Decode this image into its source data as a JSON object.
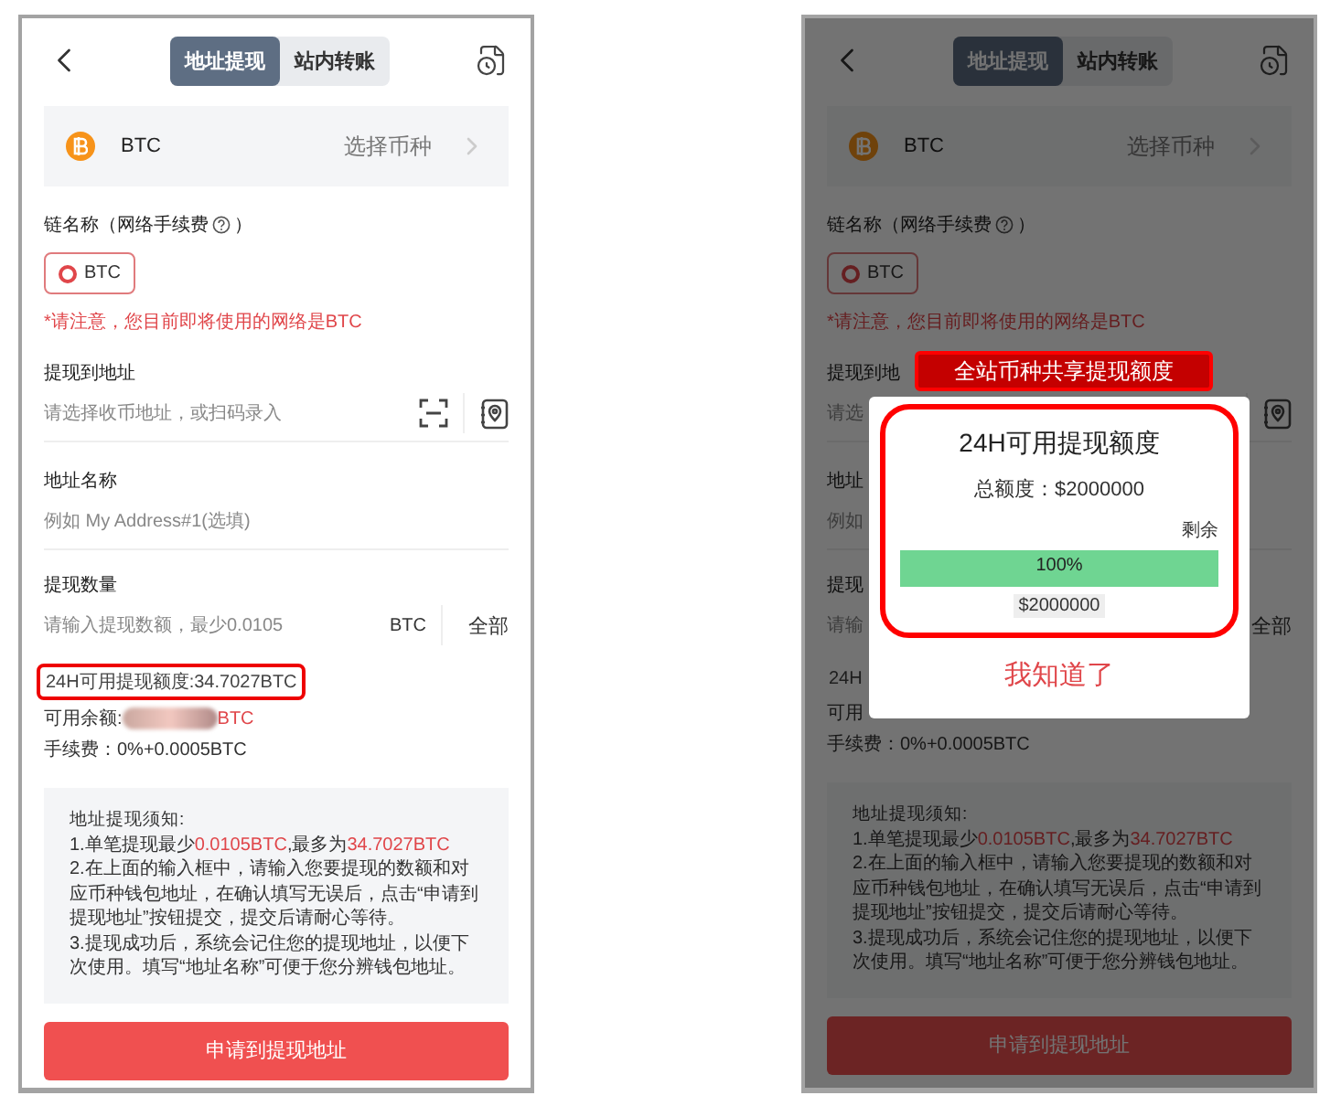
{
  "screens": [
    {
      "dimmed": false,
      "tabs": [
        {
          "label": "地址提现",
          "selected": true
        },
        {
          "label": "站内转账",
          "selected": false
        }
      ],
      "coin": {
        "symbol": "BTC",
        "action": "选择币种"
      },
      "chain": {
        "label": "链名称（网络手续费",
        "label_end": "）",
        "options": [
          {
            "label": "BTC",
            "selected": true
          }
        ],
        "note": "*请注意，您目前即将使用的网络是BTC"
      },
      "address": {
        "label": "提现到地址",
        "placeholder": "请选择收币地址，或扫码录入"
      },
      "name": {
        "label": "地址名称",
        "placeholder": "例如 My Address#1(选填)"
      },
      "amount": {
        "label": "提现数量",
        "placeholder": "请输入提现数额，最少0.0105",
        "unit": "BTC",
        "all": "全部"
      },
      "quota": {
        "text": "24H可用提现额度:34.7027BTC",
        "highlighted": true
      },
      "balance": {
        "label": "可用余额:",
        "value": "BTC",
        "redacted": true
      },
      "fee": "手续费：0%+0.0005BTC",
      "notice": {
        "title": "地址提现须知:",
        "lines": [
          [
            {
              "text": "1.单笔提现最少",
              "highlight": false
            },
            {
              "text": "0.0105BTC",
              "highlight": true
            },
            {
              "text": ",最多为",
              "highlight": false
            },
            {
              "text": "34.7027BTC",
              "highlight": true
            }
          ],
          [
            {
              "text": "2.在上面的输入框中，请输入您要提现的数额和对应币种钱包地址，在确认填写无误后，点击“申请到提现地址”按钮提交，提交后请耐心等待。",
              "highlight": false
            }
          ],
          [
            {
              "text": "3.提现成功后，系统会记住您的提现地址，以便下次使用。填写“地址名称”可便于您分辨钱包地址。",
              "highlight": false
            }
          ]
        ]
      },
      "submit": "申请到提现地址"
    },
    {
      "dimmed": true,
      "tabs": [
        {
          "label": "地址提现",
          "selected": true
        },
        {
          "label": "站内转账",
          "selected": false
        }
      ],
      "coin": {
        "symbol": "BTC",
        "action": "选择币种"
      },
      "chain": {
        "label": "链名称（网络手续费",
        "label_end": "）",
        "options": [
          {
            "label": "BTC",
            "selected": true
          }
        ],
        "note": "*请注意，您目前即将使用的网络是BTC"
      },
      "address": {
        "label": "提现到地",
        "placeholder": "请选"
      },
      "name": {
        "label": "地址",
        "placeholder": "例如"
      },
      "amount": {
        "label": "提现",
        "placeholder": "请输",
        "all": "全部"
      },
      "quota": {
        "text": "24H",
        "highlighted": false
      },
      "balance": {
        "label": "可用",
        "redacted": false
      },
      "fee": "手续费：0%+0.0005BTC",
      "notice": {
        "title": "地址提现须知:",
        "lines": [
          [
            {
              "text": "1.单笔提现最少",
              "highlight": false
            },
            {
              "text": "0.0105BTC",
              "highlight": true
            },
            {
              "text": ",最多为",
              "highlight": false
            },
            {
              "text": "34.7027BTC",
              "highlight": true
            }
          ],
          [
            {
              "text": "2.在上面的输入框中，请输入您要提现的数额和对应币种钱包地址，在确认填写无误后，点击“申请到提现地址”按钮提交，提交后请耐心等待。",
              "highlight": false
            }
          ],
          [
            {
              "text": "3.提现成功后，系统会记住您的提现地址，以便下次使用。填写“地址名称”可便于您分辨钱包地址。",
              "highlight": false
            }
          ]
        ]
      },
      "submit": "申请到提现地址",
      "dialog": {
        "banner": "全站币种共享提现额度",
        "title": "24H可用提现额度",
        "total": "总额度：$2000000",
        "remaining_label": "剩余",
        "progress": {
          "level": 1,
          "reading": "100%"
        },
        "amount": "$2000000",
        "confirm": "我知道了"
      }
    }
  ]
}
